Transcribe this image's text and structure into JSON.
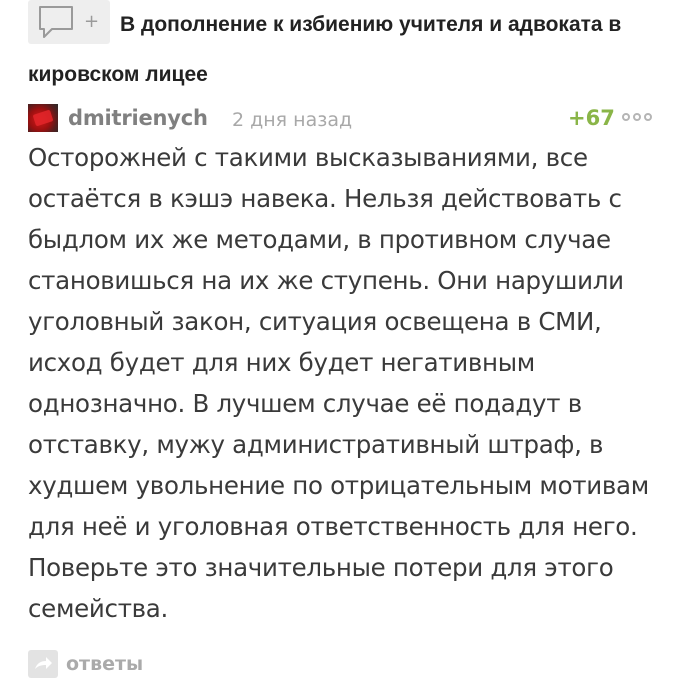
{
  "post": {
    "title": "В дополнение к избиению учителя и адвоката в кировском лицее",
    "comment_button_icon": "speech-bubble-icon",
    "add_icon_glyph": "+"
  },
  "comment": {
    "username": "dmitrienych",
    "timestamp": "2 дня назад",
    "rating": "+67",
    "avatar_icon": "avatar",
    "more_icon": "more-options-icon",
    "text": "Осторожней с такими высказываниями, все остаётся в кэшэ навека. Нельзя действовать с быдлом их же методами, в противном случае становишься на их же ступень. Они нарушили уголовный закон, ситуация освещена в СМИ, исход будет для них будет негативным однозначно. В лучшем случае её подадут в отставку, мужу административный штраф, в худшем увольнение по отрицательным мотивам для неё и уголовная ответственность для него. Поверьте это значительные потери для этого семейства."
  },
  "replies": {
    "label": "ответы",
    "icon": "reply-arrow-icon"
  },
  "colors": {
    "rating_green": "#8ab548",
    "muted_text": "#a8a8a8",
    "body_text": "#3a3a3a"
  }
}
